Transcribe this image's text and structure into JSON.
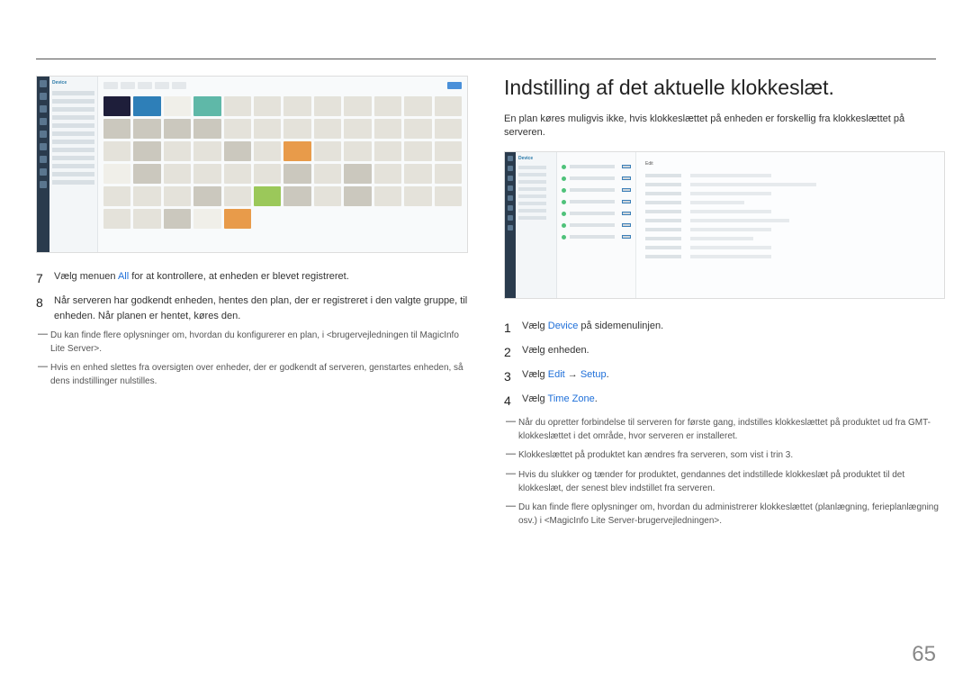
{
  "left": {
    "screenshotA_label": "Device",
    "steps": [
      {
        "num": "7",
        "parts": [
          "Vælg menuen ",
          {
            "kw": "All"
          },
          " for at kontrollere, at enheden er blevet registreret."
        ]
      },
      {
        "num": "8",
        "parts": [
          "Når serveren har godkendt enheden, hentes den plan, der er registreret i den valgte gruppe, til enheden. Når planen er hentet, køres den."
        ]
      }
    ],
    "notes": [
      "Du kan finde flere oplysninger om, hvordan du konfigurerer en plan, i <brugervejledningen til MagicInfo Lite Server>.",
      "Hvis en enhed slettes fra oversigten over enheder, der er godkendt af serveren, genstartes enheden, så dens indstillinger nulstilles."
    ]
  },
  "right": {
    "heading": "Indstilling af det aktuelle klokkeslæt.",
    "intro": "En plan køres muligvis ikke, hvis klokkeslættet på enheden er forskellig fra klokkeslættet på serveren.",
    "screenshotB_label": "Device",
    "screenshotB_tab": "Edit",
    "steps": [
      {
        "num": "1",
        "parts": [
          "Vælg ",
          {
            "kw": "Device"
          },
          " på sidemenulinjen."
        ]
      },
      {
        "num": "2",
        "parts": [
          "Vælg enheden."
        ]
      },
      {
        "num": "3",
        "parts": [
          "Vælg ",
          {
            "kw": "Edit"
          },
          " → ",
          {
            "kw": "Setup"
          },
          "."
        ]
      },
      {
        "num": "4",
        "parts": [
          "Vælg ",
          {
            "kw": "Time Zone"
          },
          "."
        ]
      }
    ],
    "notes": [
      "Når du opretter forbindelse til serveren for første gang, indstilles klokkeslættet på produktet ud fra GMT-klokkeslættet i det område, hvor serveren er installeret.",
      "Klokkeslættet på produktet kan ændres fra serveren, som vist i trin 3.",
      "Hvis du slukker og tænder for produktet, gendannes det indstillede klokkeslæt på produktet til det klokkeslæt, der senest blev indstillet fra serveren.",
      "Du kan finde flere oplysninger om, hvordan du administrerer klokkeslættet (planlægning, ferieplanlægning osv.) i <MagicInfo Lite Server-brugervejledningen>."
    ]
  },
  "page_number": "65"
}
